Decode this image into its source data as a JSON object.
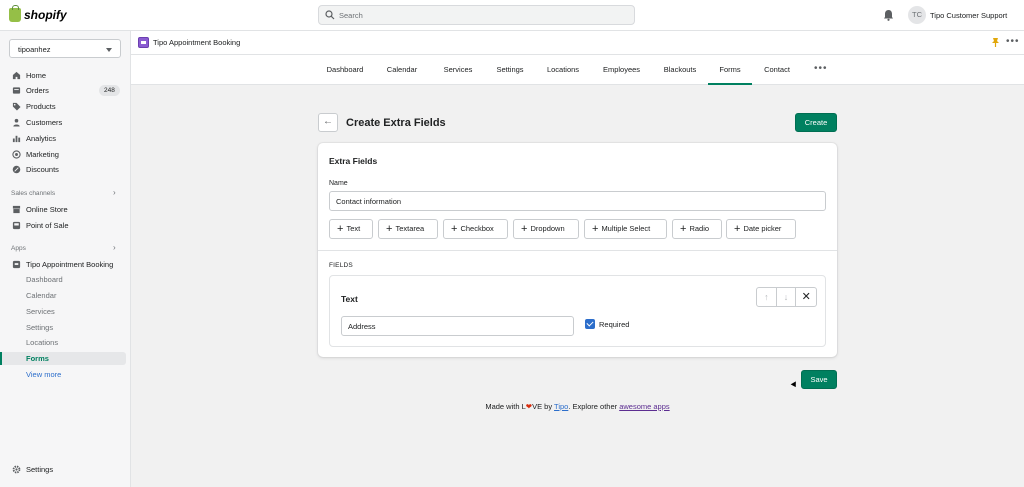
{
  "topbar": {
    "logo_text": "shopify",
    "search_placeholder": "Search",
    "avatar_initials": "TC",
    "user_name": "Tipo Customer Support"
  },
  "sidebar": {
    "store": "tipoanhez",
    "items": [
      {
        "label": "Home",
        "icon": "home-icon"
      },
      {
        "label": "Orders",
        "icon": "orders-icon",
        "badge": "248"
      },
      {
        "label": "Products",
        "icon": "tag-icon"
      },
      {
        "label": "Customers",
        "icon": "person-icon"
      },
      {
        "label": "Analytics",
        "icon": "bar-chart-icon"
      },
      {
        "label": "Marketing",
        "icon": "target-icon"
      },
      {
        "label": "Discounts",
        "icon": "discount-icon"
      }
    ],
    "sales_channels_label": "Sales channels",
    "channels": [
      {
        "label": "Online Store",
        "icon": "store-icon"
      },
      {
        "label": "Point of Sale",
        "icon": "pos-icon"
      }
    ],
    "apps_label": "Apps",
    "app_name": "Tipo Appointment Booking",
    "app_sub": [
      "Dashboard",
      "Calendar",
      "Services",
      "Settings",
      "Locations",
      "Forms"
    ],
    "view_more": "View more",
    "settings": "Settings"
  },
  "app_header": {
    "title": "Tipo Appointment Booking"
  },
  "tabs": [
    "Dashboard",
    "Calendar",
    "Services",
    "Settings",
    "Locations",
    "Employees",
    "Blackouts",
    "Forms",
    "Contact"
  ],
  "active_tab": "Forms",
  "page": {
    "title": "Create Extra Fields",
    "create_button": "Create",
    "card_title": "Extra Fields",
    "name_label": "Name",
    "name_value": "Contact information",
    "field_types": [
      "Text",
      "Textarea",
      "Checkbox",
      "Dropdown",
      "Multiple Select",
      "Radio",
      "Date picker"
    ],
    "fields_label": "FIELDS",
    "field": {
      "type": "Text",
      "value": "Address",
      "required_label": "Required",
      "required": true
    },
    "save_button": "Save"
  },
  "footer": {
    "made_with": "Made with L",
    "ve_by": "VE by ",
    "tipo": "Tipo",
    "explore": ". Explore other ",
    "awesome_apps": "awesome apps"
  },
  "colors": {
    "primary": "#008060",
    "link": "#2c6ecb",
    "checkbox": "#2c6ecb"
  }
}
